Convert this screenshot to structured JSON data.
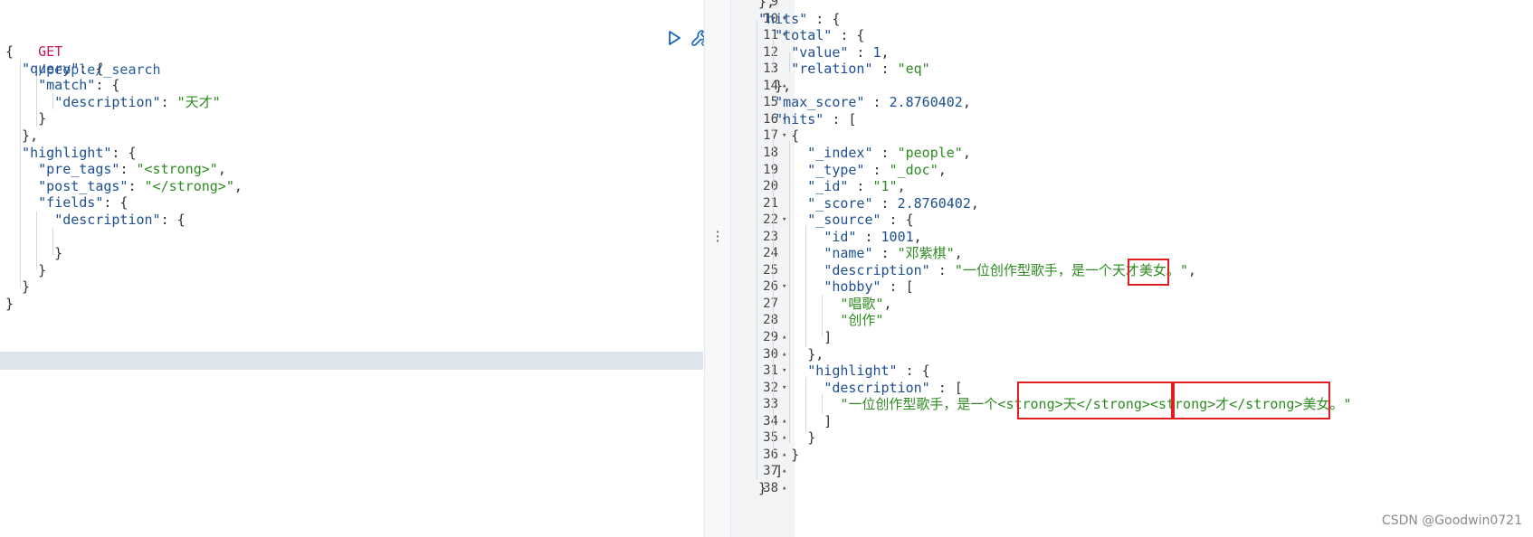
{
  "request": {
    "method": "GET",
    "path": "/people/_search",
    "lines": [
      [
        [
          "p",
          "{"
        ]
      ],
      [
        [
          "p",
          "  "
        ],
        [
          "k",
          "\"query\""
        ],
        [
          "p",
          ": {"
        ]
      ],
      [
        [
          "p",
          "    "
        ],
        [
          "k",
          "\"match\""
        ],
        [
          "p",
          ": {"
        ]
      ],
      [
        [
          "p",
          "      "
        ],
        [
          "k",
          "\"description\""
        ],
        [
          "p",
          ": "
        ],
        [
          "s",
          "\"天才\""
        ]
      ],
      [
        [
          "p",
          "    }"
        ]
      ],
      [
        [
          "p",
          "  },"
        ]
      ],
      [
        [
          "p",
          "  "
        ],
        [
          "k",
          "\"highlight\""
        ],
        [
          "p",
          ": {"
        ]
      ],
      [
        [
          "p",
          "    "
        ],
        [
          "k",
          "\"pre_tags\""
        ],
        [
          "p",
          ": "
        ],
        [
          "s",
          "\"<strong>\""
        ],
        [
          "p",
          ","
        ]
      ],
      [
        [
          "p",
          "    "
        ],
        [
          "k",
          "\"post_tags\""
        ],
        [
          "p",
          ": "
        ],
        [
          "s",
          "\"</strong>\""
        ],
        [
          "p",
          ","
        ]
      ],
      [
        [
          "p",
          "    "
        ],
        [
          "k",
          "\"fields\""
        ],
        [
          "p",
          ": {"
        ]
      ],
      [
        [
          "p",
          "      "
        ],
        [
          "k",
          "\"description\""
        ],
        [
          "p",
          ": {"
        ]
      ],
      [
        [
          "p",
          ""
        ]
      ],
      [
        [
          "p",
          "      }"
        ]
      ],
      [
        [
          "p",
          "    }"
        ]
      ],
      [
        [
          "p",
          "  }"
        ]
      ],
      [
        [
          "p",
          "}"
        ]
      ]
    ]
  },
  "actions": {
    "run_icon": "play-icon",
    "settings_icon": "wrench-icon"
  },
  "response": {
    "line_numbers": [
      "9",
      "10",
      "11",
      "12",
      "13",
      "14",
      "15",
      "16",
      "17",
      "18",
      "19",
      "20",
      "21",
      "22",
      "23",
      "24",
      "25",
      "26",
      "27",
      "28",
      "29",
      "30",
      "31",
      "32",
      "33",
      "34",
      "35",
      "36",
      "37",
      "38"
    ],
    "fold_markers": [
      "",
      "▾",
      "▾",
      "",
      "",
      "▴",
      "",
      "▾",
      "▾",
      "",
      "",
      "",
      "",
      "▾",
      "",
      "",
      "",
      "▾",
      "",
      "",
      "▴",
      "▴",
      "▾",
      "▾",
      "",
      "▴",
      "▴",
      "▴",
      "▴",
      "▴"
    ],
    "lines": [
      [
        [
          "p",
          "  },"
        ]
      ],
      [
        [
          "p",
          "  "
        ],
        [
          "k",
          "\"hits\""
        ],
        [
          "p",
          " : {"
        ]
      ],
      [
        [
          "p",
          "    "
        ],
        [
          "k",
          "\"total\""
        ],
        [
          "p",
          " : {"
        ]
      ],
      [
        [
          "p",
          "      "
        ],
        [
          "k",
          "\"value\""
        ],
        [
          "p",
          " : "
        ],
        [
          "n",
          "1"
        ],
        [
          "p",
          ","
        ]
      ],
      [
        [
          "p",
          "      "
        ],
        [
          "k",
          "\"relation\""
        ],
        [
          "p",
          " : "
        ],
        [
          "s",
          "\"eq\""
        ]
      ],
      [
        [
          "p",
          "    },"
        ]
      ],
      [
        [
          "p",
          "    "
        ],
        [
          "k",
          "\"max_score\""
        ],
        [
          "p",
          " : "
        ],
        [
          "n",
          "2.8760402"
        ],
        [
          "p",
          ","
        ]
      ],
      [
        [
          "p",
          "    "
        ],
        [
          "k",
          "\"hits\""
        ],
        [
          "p",
          " : ["
        ]
      ],
      [
        [
          "p",
          "      {"
        ]
      ],
      [
        [
          "p",
          "        "
        ],
        [
          "k",
          "\"_index\""
        ],
        [
          "p",
          " : "
        ],
        [
          "s",
          "\"people\""
        ],
        [
          "p",
          ","
        ]
      ],
      [
        [
          "p",
          "        "
        ],
        [
          "k",
          "\"_type\""
        ],
        [
          "p",
          " : "
        ],
        [
          "s",
          "\"_doc\""
        ],
        [
          "p",
          ","
        ]
      ],
      [
        [
          "p",
          "        "
        ],
        [
          "k",
          "\"_id\""
        ],
        [
          "p",
          " : "
        ],
        [
          "s",
          "\"1\""
        ],
        [
          "p",
          ","
        ]
      ],
      [
        [
          "p",
          "        "
        ],
        [
          "k",
          "\"_score\""
        ],
        [
          "p",
          " : "
        ],
        [
          "n",
          "2.8760402"
        ],
        [
          "p",
          ","
        ]
      ],
      [
        [
          "p",
          "        "
        ],
        [
          "k",
          "\"_source\""
        ],
        [
          "p",
          " : {"
        ]
      ],
      [
        [
          "p",
          "          "
        ],
        [
          "k",
          "\"id\""
        ],
        [
          "p",
          " : "
        ],
        [
          "n",
          "1001"
        ],
        [
          "p",
          ","
        ]
      ],
      [
        [
          "p",
          "          "
        ],
        [
          "k",
          "\"name\""
        ],
        [
          "p",
          " : "
        ],
        [
          "s",
          "\"邓紫棋\""
        ],
        [
          "p",
          ","
        ]
      ],
      [
        [
          "p",
          "          "
        ],
        [
          "k",
          "\"description\""
        ],
        [
          "p",
          " : "
        ],
        [
          "s",
          "\"一位创作型歌手，是一个天才美女。\""
        ],
        [
          "p",
          ","
        ]
      ],
      [
        [
          "p",
          "          "
        ],
        [
          "k",
          "\"hobby\""
        ],
        [
          "p",
          " : ["
        ]
      ],
      [
        [
          "p",
          "            "
        ],
        [
          "s",
          "\"唱歌\""
        ],
        [
          "p",
          ","
        ]
      ],
      [
        [
          "p",
          "            "
        ],
        [
          "s",
          "\"创作\""
        ]
      ],
      [
        [
          "p",
          "          ]"
        ]
      ],
      [
        [
          "p",
          "        },"
        ]
      ],
      [
        [
          "p",
          "        "
        ],
        [
          "k",
          "\"highlight\""
        ],
        [
          "p",
          " : {"
        ]
      ],
      [
        [
          "p",
          "          "
        ],
        [
          "k",
          "\"description\""
        ],
        [
          "p",
          " : ["
        ]
      ],
      [
        [
          "p",
          "            "
        ],
        [
          "s",
          "\"一位创作型歌手，是一个<strong>天</strong><strong>才</strong>美女。\""
        ]
      ],
      [
        [
          "p",
          "          ]"
        ]
      ],
      [
        [
          "p",
          "        }"
        ]
      ],
      [
        [
          "p",
          "      }"
        ]
      ],
      [
        [
          "p",
          "    ]"
        ]
      ],
      [
        [
          "p",
          "  }"
        ]
      ]
    ]
  },
  "watermark": "CSDN @Goodwin0721",
  "colors": {
    "method": "#c2185b",
    "key": "#1d4f91",
    "string": "#2e8b22",
    "highlight_box": "#e02020"
  }
}
